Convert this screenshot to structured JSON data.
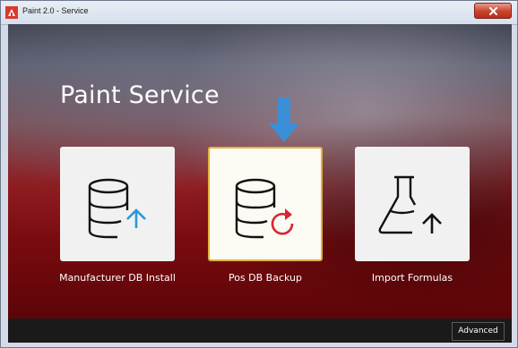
{
  "window": {
    "title": "Paint 2.0 - Service",
    "close_icon": "close-icon",
    "app_icon": "paint-app-icon"
  },
  "main": {
    "title": "Paint Service",
    "hint_icon": "down-arrow-icon",
    "tiles": [
      {
        "label": "Manufacturer DB Install",
        "icon": "database-upload-icon",
        "selected": false
      },
      {
        "label": "Pos DB Backup",
        "icon": "database-refresh-icon",
        "selected": true
      },
      {
        "label": "Import Formulas",
        "icon": "flask-upload-icon",
        "selected": false
      }
    ]
  },
  "footer": {
    "advanced_label": "Advanced"
  },
  "colors": {
    "accent_blue": "#2a97d8",
    "refresh_red": "#d8262f",
    "selection_border": "#e4b13a",
    "arrow_blue": "#3b8fd6"
  }
}
